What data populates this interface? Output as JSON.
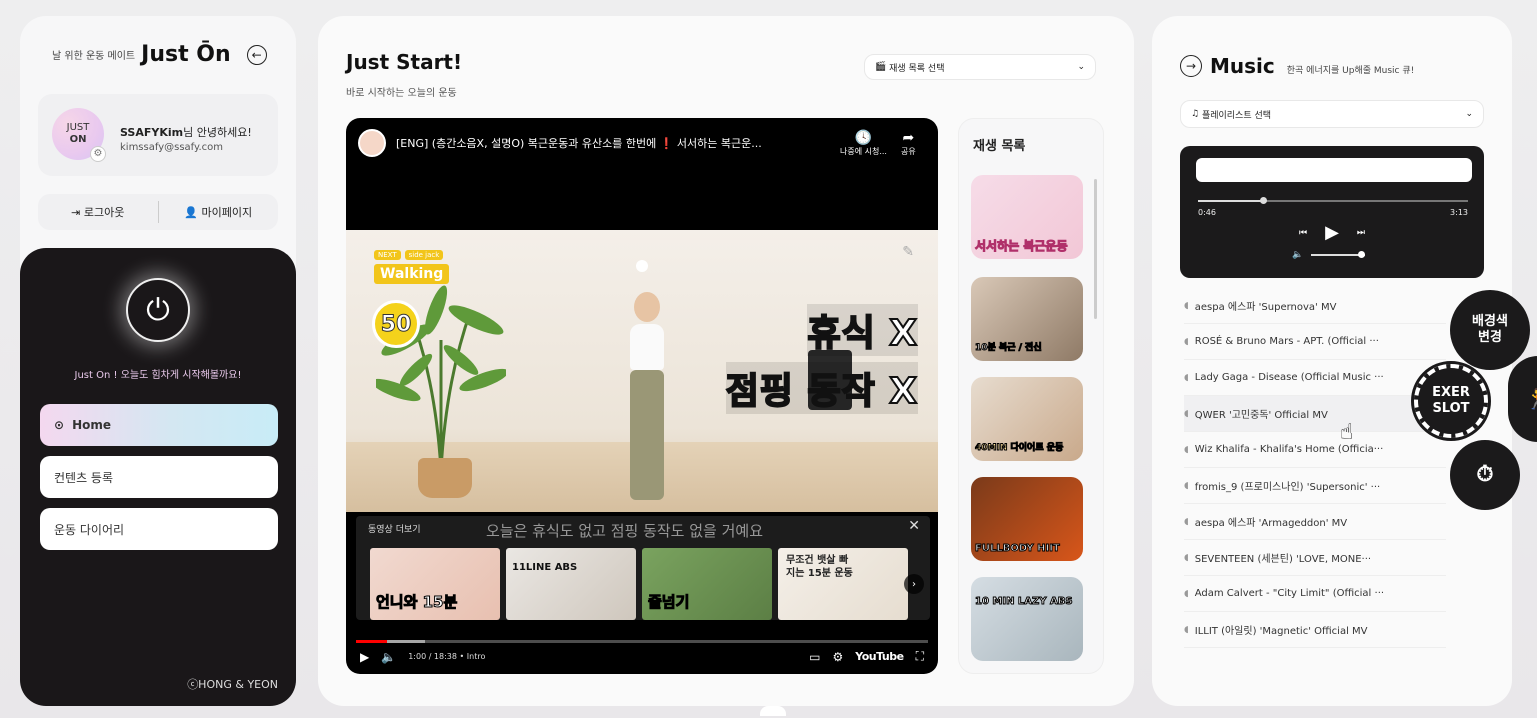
{
  "left": {
    "brand_sub": "날 위한 운동 메이트",
    "brand_logo": "Just Ōn",
    "back_icon": "back-arrow-icon",
    "avatar_line1": "JUST",
    "avatar_line2": "ON",
    "user_name": "SSAFYKim",
    "user_greeting": "님 안녕하세요!",
    "user_email": "kimssafy@ssafy.com",
    "logout_label": "로그아웃",
    "mypage_label": "마이페이지",
    "dark_message": "Just On ! 오늘도 힘차게 시작해볼까요!",
    "menu": [
      {
        "label": "Home",
        "active": true
      },
      {
        "label": "컨텐츠 등록",
        "active": false
      },
      {
        "label": "운동 다이어리",
        "active": false
      }
    ],
    "copyright": "ⓒHONG & YEON"
  },
  "main": {
    "title": "Just Start!",
    "subtitle": "바로 시작하는 오늘의 운동",
    "playlist_select": "재생 목록 선택",
    "video": {
      "title": "[ENG] (층간소음X, 설명O) 복근운동과 유산소를 한번에 ❗ 서서하는 복근운...",
      "watch_later": "나중에 시청...",
      "share": "공유",
      "next_tag": "NEXT",
      "next_move_tag": "side jack",
      "next_move": "Walking",
      "timer": "50",
      "overlay_line1": "휴식 X",
      "overlay_line2": "점핑 동작 X",
      "more_videos": "동영상 더보기",
      "caption": "오늘은 휴식도 없고 점핑 동작도 없을 거예요",
      "suggestions": [
        "언니와 15분",
        "11LINE ABS",
        "줄넘기",
        "무조건 뱃살 빠지는 15분 운동"
      ],
      "time": "1:00 / 18:38 • Intro",
      "progress": 0.054,
      "buffered": 0.12,
      "logo": "YouTube"
    },
    "playlist": {
      "heading": "재생 목록",
      "items": [
        "서서하는 복근운동",
        "10분 복근 / 전신",
        "40MIN 다이어트 운동",
        "FULLBODY HIIT",
        "10 MIN LAZY ABS"
      ]
    }
  },
  "right": {
    "title": "Music",
    "subtitle": "한곡 에너지를 Up해줄 Music 큐!",
    "playlist_select": "플레이리스트 선택",
    "player": {
      "elapsed": "0:46",
      "total": "3:13",
      "progress": 0.24
    },
    "songs": [
      "aespa 에스파 'Supernova' MV",
      "ROSÉ & Bruno Mars - APT. (Official ···",
      "Lady Gaga - Disease (Official Music ···",
      "QWER '고민중독' Official MV",
      "Wiz Khalifa - Khalifa's Home (Officia···",
      "fromis_9 (프로미스나인) 'Supersonic' ···",
      "aespa 에스파 'Armageddon' MV",
      "SEVENTEEN (세븐틴) 'LOVE, MONE···",
      "Adam Calvert - \"City Limit\" (Official ···",
      "ILLIT (아일릿) 'Magnetic' Official MV"
    ]
  },
  "floating": {
    "bg_change": "배경색\n변경",
    "exer_slot": "EXER\nSLOT"
  },
  "colors": {
    "dark": "#1b1a1b",
    "active_gradient_start": "#f4d8ef",
    "active_gradient_end": "#c8ecf7",
    "progress_red": "#ff0000"
  }
}
